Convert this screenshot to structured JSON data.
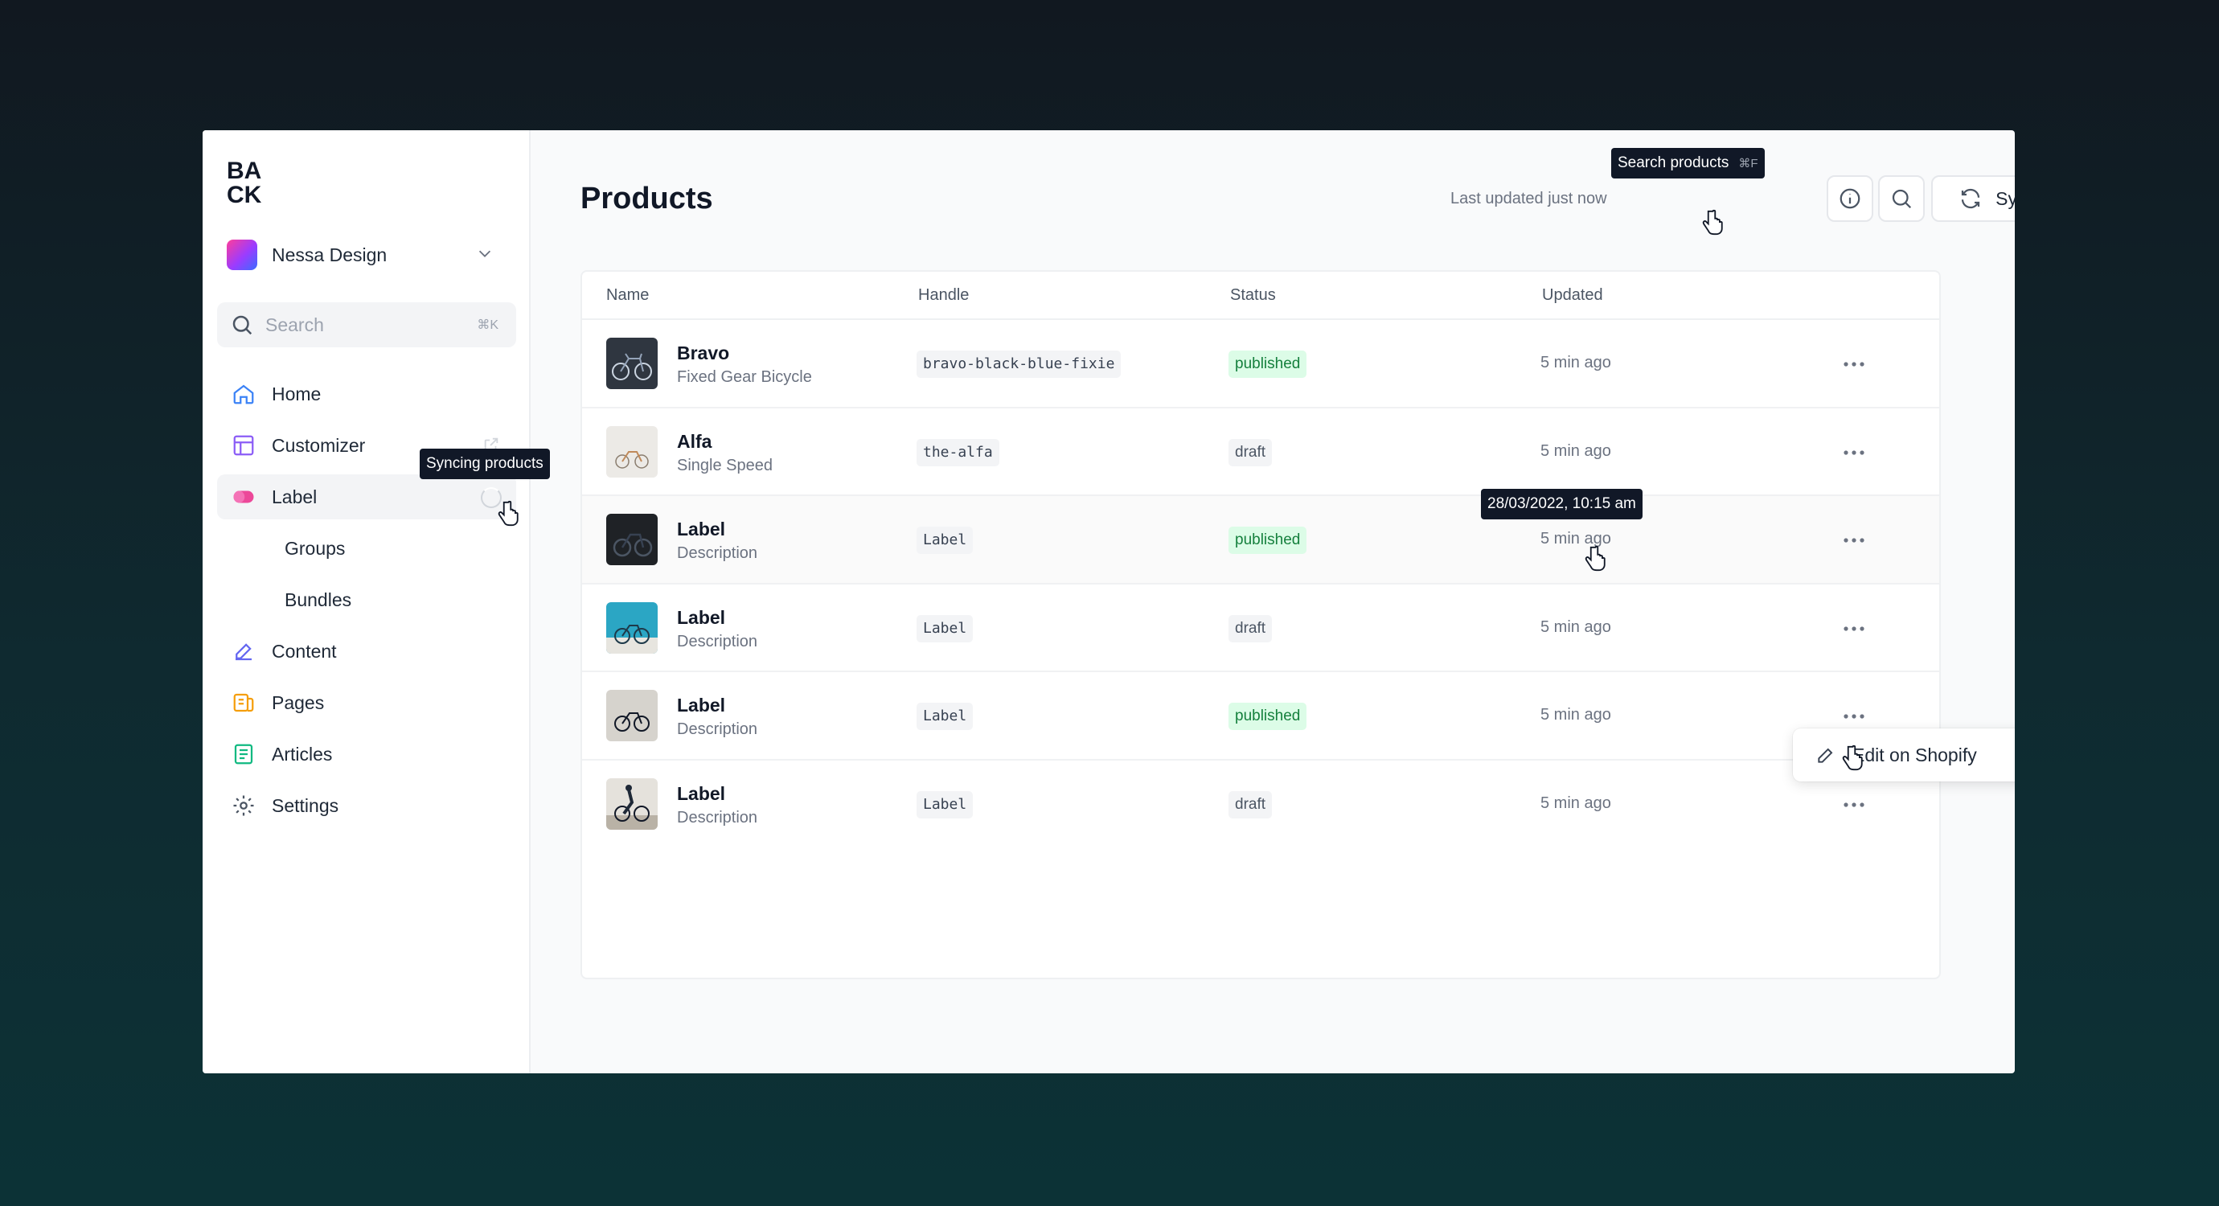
{
  "sidebar": {
    "workspace_name": "Nessa Design",
    "search": {
      "placeholder": "Search",
      "shortcut": "⌘K"
    },
    "items": [
      {
        "label": "Home",
        "icon": "home-icon",
        "color": "#3b82f6"
      },
      {
        "label": "Customizer",
        "icon": "layout-icon",
        "color": "#8b5cf6"
      },
      {
        "label": "Label",
        "icon": "label-tag-icon",
        "color": "#ec4899",
        "active": true,
        "tooltip": "Syncing products"
      },
      {
        "label": "Groups",
        "sub": true
      },
      {
        "label": "Bundles",
        "sub": true
      },
      {
        "label": "Content",
        "icon": "pencil-icon",
        "color": "#6366f1"
      },
      {
        "label": "Pages",
        "icon": "pages-icon",
        "color": "#f59e0b"
      },
      {
        "label": "Articles",
        "icon": "articles-icon",
        "color": "#10b981"
      },
      {
        "label": "Settings",
        "icon": "gear-icon",
        "color": "#4b5563"
      }
    ]
  },
  "header": {
    "title": "Products",
    "last_updated": "Last updated just now",
    "search_tooltip": "Search products",
    "search_tooltip_kbd": "⌘F",
    "sync_label": "Sync products"
  },
  "table": {
    "columns": [
      "Name",
      "Handle",
      "Status",
      "Updated"
    ],
    "rows": [
      {
        "name": "Bravo",
        "description": "Fixed Gear Bicycle",
        "handle": "bravo-black-blue-fixie",
        "status": "published",
        "updated": "5 min ago"
      },
      {
        "name": "Alfa",
        "description": "Single Speed",
        "handle": "the-alfa",
        "status": "draft",
        "updated": "5 min ago"
      },
      {
        "name": "Label",
        "description": "Description",
        "handle": "Label",
        "status": "published",
        "updated": "5 min ago",
        "tooltip": "28/03/2022, 10:15 am"
      },
      {
        "name": "Label",
        "description": "Description",
        "handle": "Label",
        "status": "draft",
        "updated": "5 min ago"
      },
      {
        "name": "Label",
        "description": "Description",
        "handle": "Label",
        "status": "published",
        "updated": "5 min ago"
      },
      {
        "name": "Label",
        "description": "Description",
        "handle": "Label",
        "status": "draft",
        "updated": "5 min ago"
      }
    ]
  },
  "context_menu": {
    "item": "Edit on Shopify"
  },
  "colors": {
    "published_bg": "#dcfce7",
    "published_text": "#15803d",
    "draft_bg": "#f3f4f6"
  }
}
